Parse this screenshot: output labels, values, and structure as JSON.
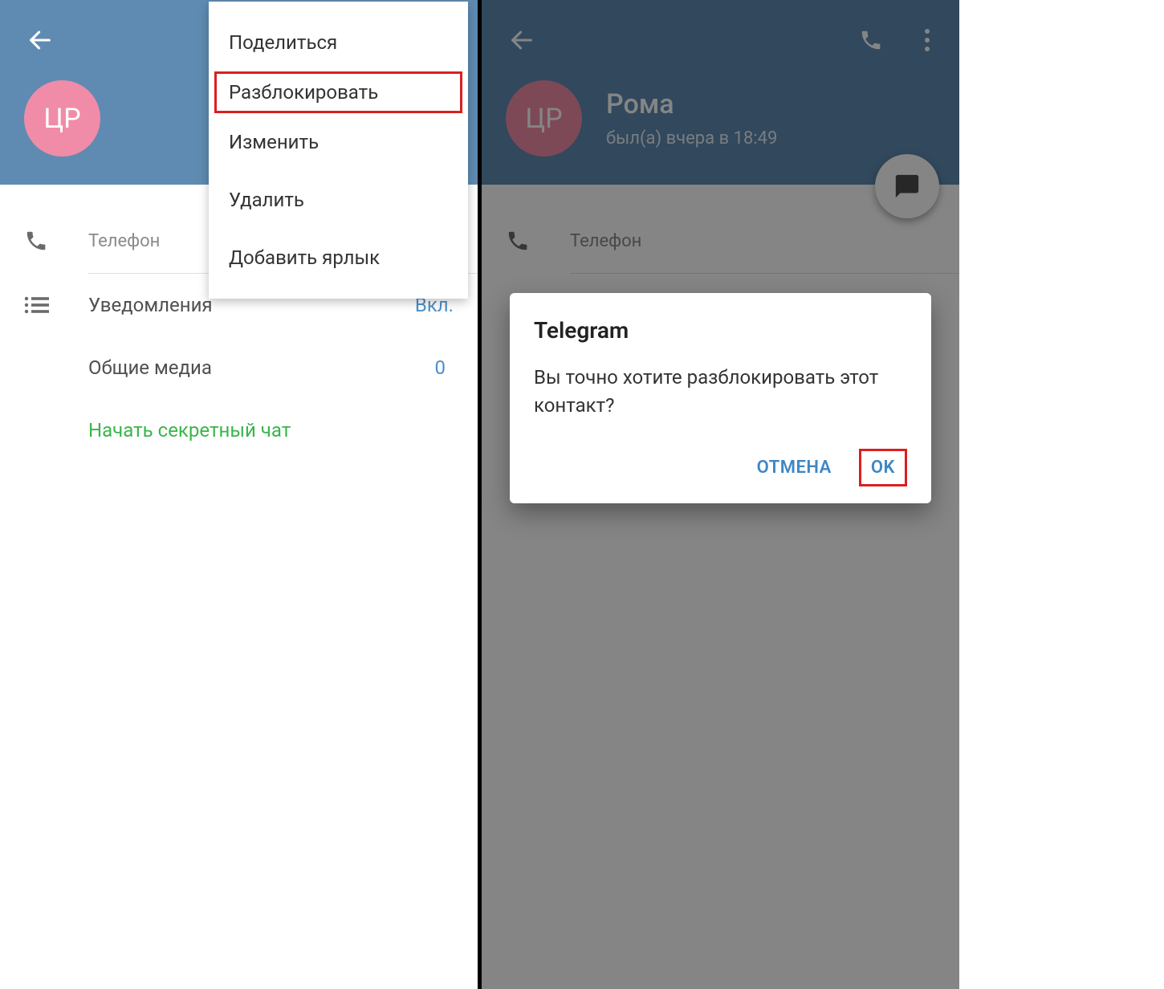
{
  "left": {
    "avatar_initials": "ЦР",
    "phone_section_label": "Телефон",
    "notifications_label": "Уведомления",
    "notifications_value": "Вкл.",
    "shared_media_label": "Общие медиа",
    "shared_media_value": "0",
    "secret_chat_label": "Начать секретный чат",
    "menu": {
      "share": "Поделиться",
      "unblock": "Разблокировать",
      "edit": "Изменить",
      "delete": "Удалить",
      "add_shortcut": "Добавить ярлык"
    }
  },
  "right": {
    "avatar_initials": "ЦР",
    "profile_name": "Рома",
    "profile_status": "был(а) вчера в 18:49",
    "phone_section_label": "Телефон",
    "dialog": {
      "title": "Telegram",
      "message": "Вы точно хотите разблокировать этот контакт?",
      "cancel": "ОТМЕНА",
      "ok": "OK"
    }
  },
  "colors": {
    "header": "#5f8bb2",
    "avatar": "#f08ca8",
    "accent": "#4c8fcb",
    "green": "#3ab54a",
    "highlight": "#d92020"
  }
}
